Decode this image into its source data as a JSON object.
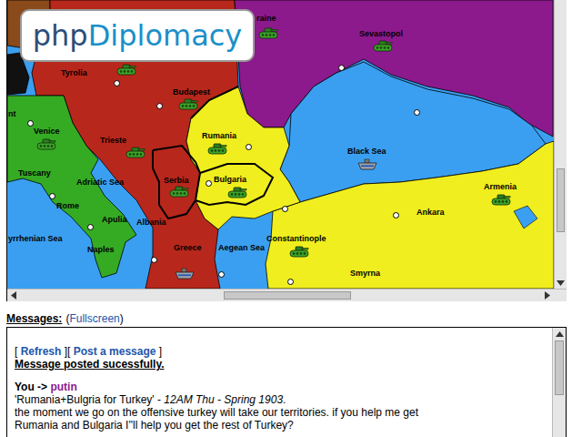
{
  "logo": {
    "prefix": "php",
    "name": "Diplomacy"
  },
  "map": {
    "regions": [
      {
        "color": "#8a4a1a"
      },
      {
        "color": "#b8271c"
      },
      {
        "color": "#35ab24"
      },
      {
        "color": "#111111"
      },
      {
        "color": "#8c1a8c"
      },
      {
        "color": "#3a9ff0"
      },
      {
        "color": "#f0ee1e"
      },
      {
        "color": "#f0ee1e"
      }
    ],
    "labels": [
      {
        "text": "raine"
      },
      {
        "text": "Sevastopol"
      },
      {
        "text": "Tyrolia"
      },
      {
        "text": "Budapest"
      },
      {
        "text": "nt"
      },
      {
        "text": "Rumania"
      },
      {
        "text": "Venice"
      },
      {
        "text": "Trieste"
      },
      {
        "text": "Black Sea"
      },
      {
        "text": "Tuscany"
      },
      {
        "text": "Adriatic Sea"
      },
      {
        "text": "Serbia"
      },
      {
        "text": "Bulgaria"
      },
      {
        "text": "Armenia"
      },
      {
        "text": "Rome"
      },
      {
        "text": "Ankara"
      },
      {
        "text": "Apulia"
      },
      {
        "text": "Albania"
      },
      {
        "text": "yrrhenian Sea"
      },
      {
        "text": "Constantinople"
      },
      {
        "text": "Naples"
      },
      {
        "text": "Greece"
      },
      {
        "text": "Aegean Sea"
      },
      {
        "text": "Smyrna"
      }
    ],
    "units": [
      {
        "kind": "army"
      },
      {
        "kind": "army"
      },
      {
        "kind": "army"
      },
      {
        "kind": "army"
      },
      {
        "kind": "army"
      },
      {
        "kind": "army"
      },
      {
        "kind": "army"
      },
      {
        "kind": "army"
      },
      {
        "kind": "army"
      },
      {
        "kind": "army"
      },
      {
        "kind": "army"
      },
      {
        "kind": "fleet"
      },
      {
        "kind": "fleet"
      }
    ]
  },
  "messages": {
    "label": "Messages:",
    "fullscreen": {
      "open": "(",
      "link": "Fullscreen",
      "close": ")"
    },
    "toolbar": [
      {
        "text": "[ ",
        "kind": "text"
      },
      {
        "text": "Refresh",
        "kind": "link"
      },
      {
        "text": " ][ ",
        "kind": "text"
      },
      {
        "text": "Post a message",
        "kind": "link"
      },
      {
        "text": " ]",
        "kind": "text"
      }
    ],
    "notice": "Message posted sucessfully.",
    "message": {
      "from": "You",
      "arrow": " -> ",
      "to": "putin",
      "subject": "'Rumania+Bulgria for Turkey'",
      "separator": " - ",
      "time": "12AM Thu - Spring 1903",
      "end": ".",
      "body": [
        "the moment we go on the offensive turkey will take our territories. if you help me get",
        "Rumania and Bulgaria I''ll help you get the rest of Turkey?"
      ]
    }
  }
}
